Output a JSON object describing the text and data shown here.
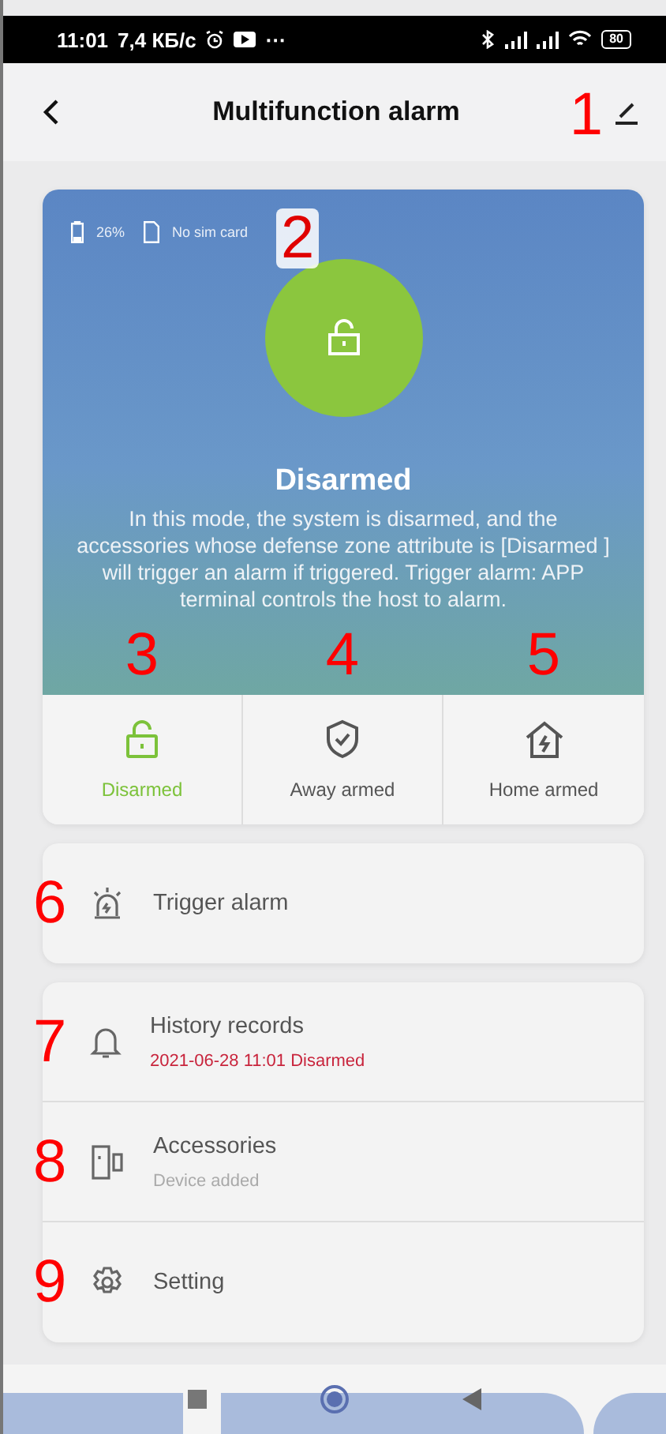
{
  "status_bar": {
    "time": "11:01",
    "speed": "7,4 КБ/с",
    "more": "···",
    "battery": "80"
  },
  "header": {
    "title": "Multifunction alarm",
    "marker": "1"
  },
  "device": {
    "battery": "26%",
    "sim": "No sim card",
    "marker": "2",
    "state_title": "Disarmed",
    "description": "In this mode, the system is disarmed, and the accessories whose defense zone attribute is [Disarmed ] will trigger an alarm if triggered. Trigger alarm: APP terminal controls the host to alarm."
  },
  "modes": [
    {
      "kind": "disarmed",
      "label": "Disarmed",
      "selected": true,
      "marker": "3"
    },
    {
      "kind": "away",
      "label": "Away armed",
      "selected": false,
      "marker": "4"
    },
    {
      "kind": "home",
      "label": "Home armed",
      "selected": false,
      "marker": "5"
    }
  ],
  "trigger": {
    "label": "Trigger alarm",
    "marker": "6"
  },
  "menu": [
    {
      "kind": "history",
      "label": "History records",
      "subtitle": "2021-06-28 11:01 Disarmed",
      "alert": true,
      "marker": "7"
    },
    {
      "kind": "accessories",
      "label": "Accessories",
      "subtitle": "Device added",
      "alert": false,
      "marker": "8"
    },
    {
      "kind": "setting",
      "label": "Setting",
      "marker": "9"
    }
  ]
}
